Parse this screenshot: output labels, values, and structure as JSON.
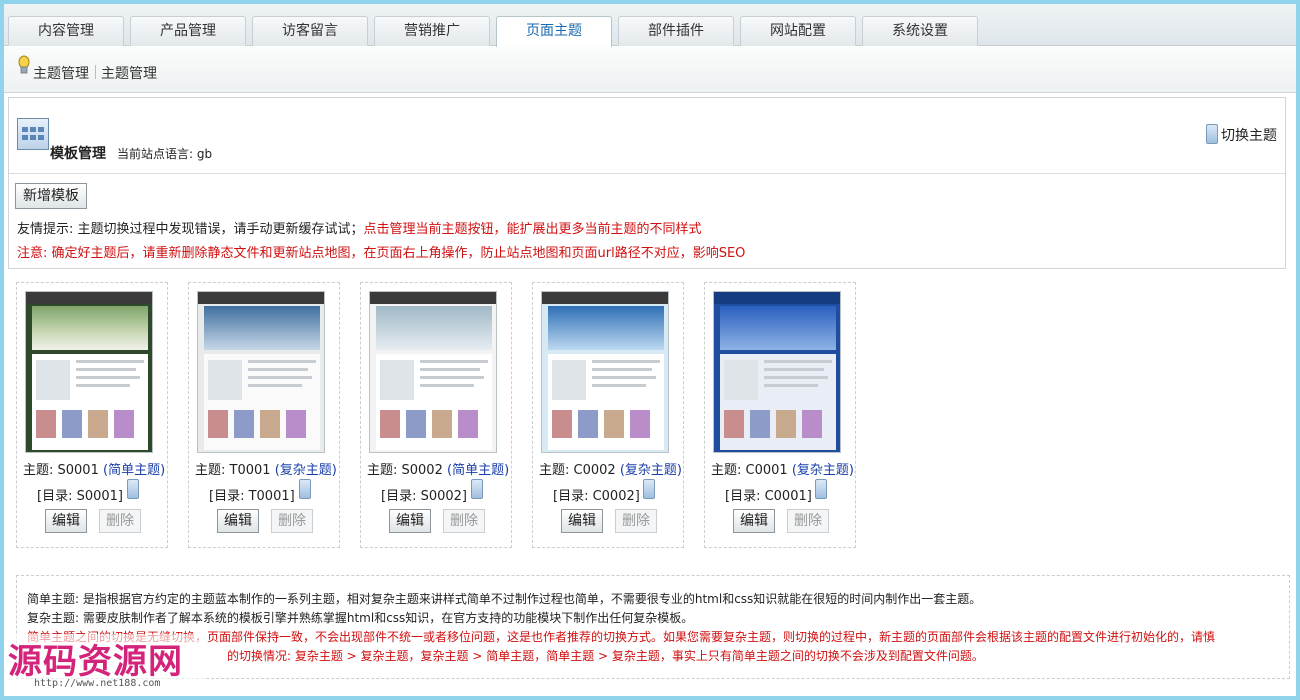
{
  "tabs": [
    "内容管理",
    "产品管理",
    "访客留言",
    "营销推广",
    "页面主题",
    "部件插件",
    "网站配置",
    "系统设置"
  ],
  "active_tab": "页面主题",
  "breadcrumb": [
    "主题管理",
    "主题管理"
  ],
  "header": {
    "title": "模板管理",
    "lang_label": "当前站点语言: gb",
    "switch_label": "切换主题"
  },
  "add_button": "新增模板",
  "tip": {
    "black": "友情提示: 主题切换过程中发现错误，请手动更新缓存试试；",
    "red": "点击管理当前主题按钮，能扩展出更多当前主题的不同样式"
  },
  "warning": "注意: 确定好主题后，请重新删除静态文件和更新站点地图，在页面右上角操作，防止站点地图和页面url路径不对应，影响SEO",
  "themes": [
    {
      "prefix": "主题: S0001",
      "type": "(简单主题)",
      "dir": "[目录: S0001]",
      "edit": "编辑",
      "del": "删除"
    },
    {
      "prefix": "主题: T0001",
      "type": "(复杂主题)",
      "dir": "[目录: T0001]",
      "edit": "编辑",
      "del": "删除"
    },
    {
      "prefix": "主题: S0002",
      "type": "(简单主题)",
      "dir": "[目录: S0002]",
      "edit": "编辑",
      "del": "删除"
    },
    {
      "prefix": "主题: C0002",
      "type": "(复杂主题)",
      "dir": "[目录: C0002]",
      "edit": "编辑",
      "del": "删除"
    },
    {
      "prefix": "主题: C0001",
      "type": "(复杂主题)",
      "dir": "[目录: C0001]",
      "edit": "编辑",
      "del": "删除"
    }
  ],
  "notes": [
    "简单主题: 是指根据官方约定的主题蓝本制作的一系列主题，相对复杂主题来讲样式简单不过制作过程也简单，不需要很专业的html和css知识就能在很短的时间内制作出一套主题。",
    "复杂主题: 需要皮肤制作者了解本系统的模板引擎并熟练掌握html和css知识，在官方支持的功能模块下制作出任何复杂模板。",
    "简单主题之间的切换是无缝切换，页面部件保持一致，不会出现部件不统一或者移位问题，这是也作者推荐的切换方式。如果您需要复杂主题，则切换的过程中，新主题的页面部件会根据该主题的配置文件进行初始化的，请慎",
    "的切换情况: 复杂主题 > 复杂主题，复杂主题 > 简单主题，简单主题 > 复杂主题，事实上只有简单主题之间的切换不会涉及到配置文件问题。"
  ],
  "watermark": {
    "text": "源码资源网",
    "url": "http://www.net188.com"
  }
}
